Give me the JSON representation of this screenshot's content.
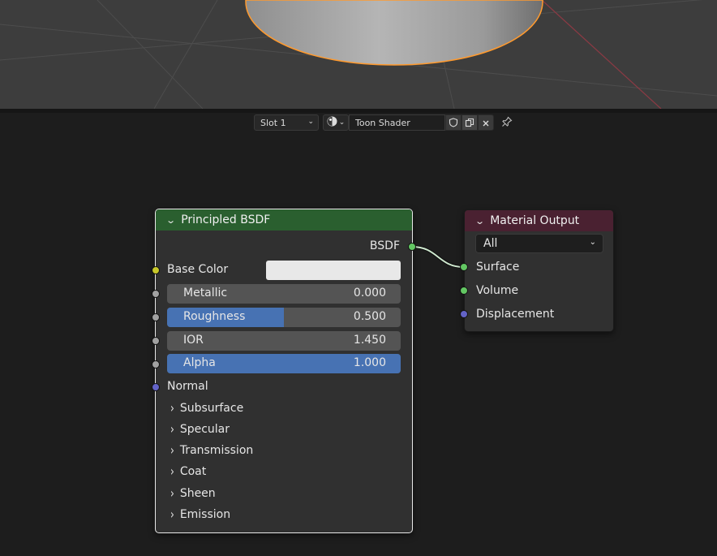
{
  "header": {
    "slot_label": "Slot 1",
    "material_name": "Toon Shader"
  },
  "bsdf_node": {
    "title": "Principled BSDF",
    "output_label": "BSDF",
    "base_color_label": "Base Color",
    "fields": [
      {
        "label": "Metallic",
        "value": "0.000",
        "fill": 0.0
      },
      {
        "label": "Roughness",
        "value": "0.500",
        "fill": 0.5
      },
      {
        "label": "IOR",
        "value": "1.450",
        "fill": 0.0
      },
      {
        "label": "Alpha",
        "value": "1.000",
        "fill": 1.0
      }
    ],
    "normal_label": "Normal",
    "panels": [
      "Subsurface",
      "Specular",
      "Transmission",
      "Coat",
      "Sheen",
      "Emission"
    ]
  },
  "output_node": {
    "title": "Material Output",
    "target": "All",
    "inputs": [
      "Surface",
      "Volume",
      "Displacement"
    ]
  },
  "colors": {
    "selection_outline": "#ff9a2e",
    "shader_socket": "#63c763",
    "color_socket": "#c7c729",
    "float_socket": "#a1a1a1",
    "vector_socket": "#6363c7",
    "slider_fill": "#4772b3",
    "shader_header": "#2a5f2f",
    "output_header": "#4a2131"
  }
}
